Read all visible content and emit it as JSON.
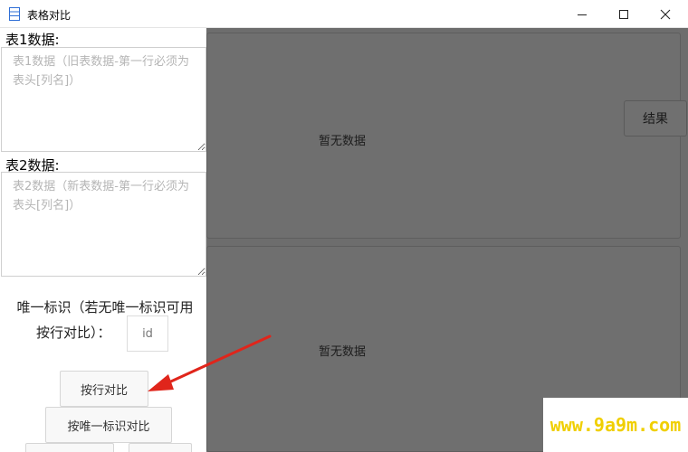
{
  "window": {
    "title": "表格对比",
    "icon": "table-document-icon"
  },
  "left_panel": {
    "table1": {
      "label": "表1数据:",
      "value": "",
      "placeholder": "表1数据（旧表数据-第一行必须为表头[列名]）"
    },
    "table2": {
      "label": "表2数据:",
      "value": "",
      "placeholder": "表2数据（新表数据-第一行必须为表头[列名]）"
    },
    "unique_id": {
      "label_line1": "唯一标识（若无唯一标识可用",
      "label_line2": "按行对比）：",
      "value": "",
      "placeholder": "id"
    },
    "buttons": {
      "row_compare": "按行对比",
      "unique_compare": "按唯一标识对比"
    }
  },
  "right_panel": {
    "top_empty": "暂无数据",
    "bottom_empty": "暂无数据",
    "result_button": "结果"
  },
  "watermark": "www.9a9m.com",
  "colors": {
    "overlay": "#6d6d6d",
    "arrow": "#e0251b",
    "watermark": "#f0cf00"
  }
}
